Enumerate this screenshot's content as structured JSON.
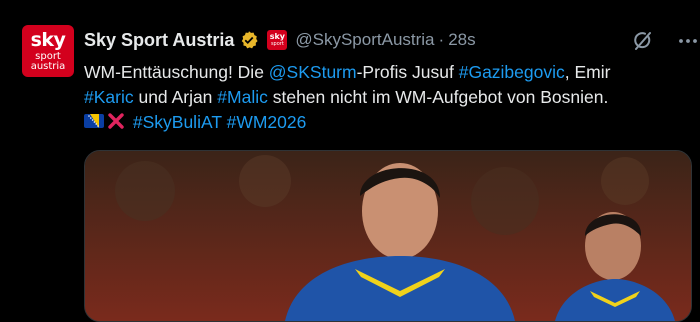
{
  "account": {
    "avatar_line1": "sky",
    "avatar_line2": "sport",
    "avatar_line3": "austria",
    "name": "Sky Sport Austria",
    "affiliate_badge_line1": "sky",
    "affiliate_badge_line2": "sport",
    "handle": "@SkySportAustria",
    "separator": "·",
    "time": "28s"
  },
  "tweet": {
    "t1": "WM-Enttäuschung! Die ",
    "mention": "@SKSturm",
    "t2": "-Profis Jusuf ",
    "hash1": "#Gazibegovic",
    "t3": ", Emir ",
    "hash2": "#Karic",
    "t4": " und Arjan ",
    "hash3": "#Malic",
    "t5": " stehen nicht im WM-Aufgebot von Bosnien.",
    "hash4": "#SkyBuliAT",
    "hash5": "#WM2026"
  },
  "icons": {
    "verified": "verified-badge-icon",
    "flag": "bosnia-flag-icon",
    "cross": "cross-mark-icon",
    "grok": "grok-icon",
    "more": "more-icon"
  },
  "colors": {
    "background": "#000000",
    "text": "#e7e9ea",
    "secondary": "#8b98a5",
    "link": "#1d9bf0",
    "brand": "#d3001d",
    "verified": "#e8b62a"
  }
}
